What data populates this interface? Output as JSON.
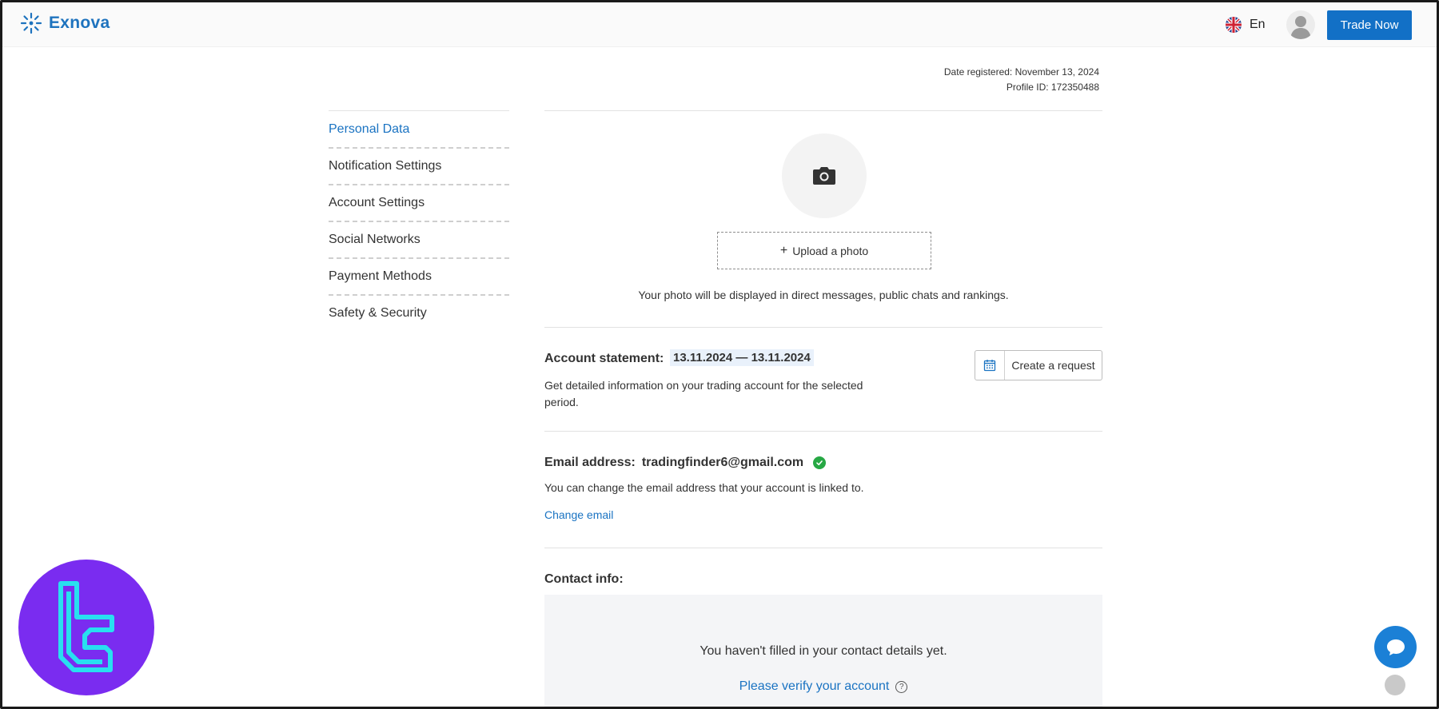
{
  "header": {
    "brand": "Exnova",
    "language": "En",
    "trade_button": "Trade Now"
  },
  "account_meta": {
    "date_registered": "Date registered: November 13, 2024",
    "profile_id": "Profile ID: 172350488"
  },
  "sidebar": {
    "items": [
      {
        "label": "Personal Data",
        "active": true
      },
      {
        "label": "Notification Settings",
        "active": false
      },
      {
        "label": "Account Settings",
        "active": false
      },
      {
        "label": "Social Networks",
        "active": false
      },
      {
        "label": "Payment Methods",
        "active": false
      },
      {
        "label": "Safety & Security",
        "active": false
      }
    ]
  },
  "photo": {
    "upload_label": "Upload a photo",
    "note": "Your photo will be displayed in direct messages, public chats and rankings."
  },
  "statement": {
    "title": "Account statement:",
    "dates": "13.11.2024 — 13.11.2024",
    "description": "Get detailed information on your trading account for the selected period.",
    "button": "Create a request"
  },
  "email": {
    "title": "Email address:",
    "value": "tradingfinder6@gmail.com",
    "description": "You can change the email address that your account is linked to.",
    "change_link": "Change email"
  },
  "contact": {
    "title": "Contact info:",
    "message": "You haven't filled in your contact details yet.",
    "verify_link": "Please verify your account",
    "help_glyph": "?"
  },
  "colors": {
    "brand_blue": "#1e73be",
    "button_blue": "#1270c6",
    "link_blue": "#1a73c2",
    "verified_green": "#27a844",
    "watermark_purple": "#7a2cf0",
    "watermark_cyan": "#28e0f0"
  }
}
